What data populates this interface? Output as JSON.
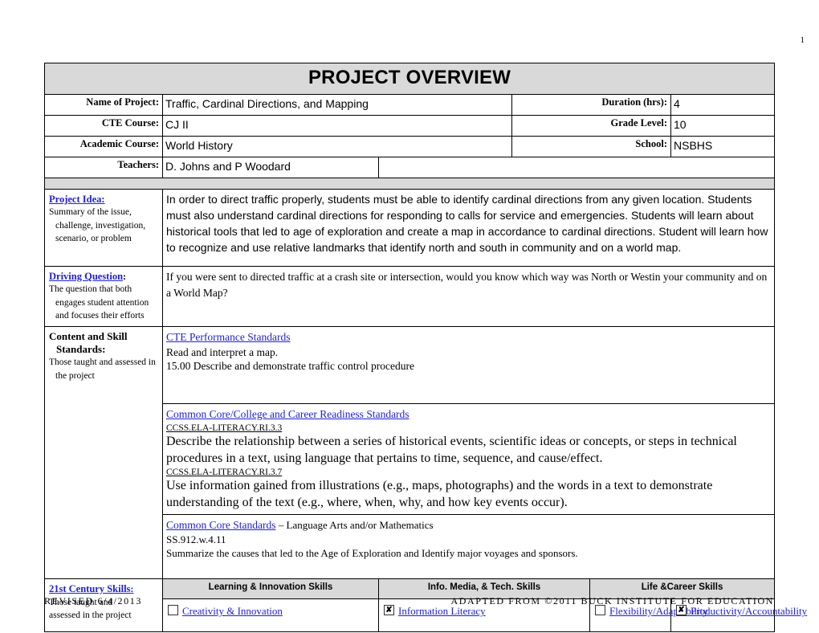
{
  "page_number": "1",
  "header": {
    "title": "PROJECT OVERVIEW"
  },
  "info_fields": {
    "name_of_project_label": "Name of Project:",
    "name_of_project_value": "Traffic, Cardinal Directions, and Mapping",
    "duration_label": "Duration (hrs):",
    "duration_value": "4",
    "cte_course_label": "CTE Course:",
    "cte_course_value": "CJ II",
    "grade_level_label": "Grade Level:",
    "grade_level_value": "10",
    "academic_course_label": "Academic Course:",
    "academic_course_value": "World History",
    "school_label": "School:",
    "school_value": "NSBHS",
    "teachers_label": "Teachers:",
    "teachers_value": "D. Johns and P Woodard"
  },
  "project_idea": {
    "label": "Project Idea:",
    "sub_lines": [
      "Summary of the issue,",
      "challenge, investigation,",
      "scenario, or problem"
    ],
    "text": "In order to direct traffic properly, students must be able to identify cardinal directions from any given location. Students must also understand cardinal directions for responding to calls for service and emergencies. Students will learn about historical tools that led to age of exploration and create a map in accordance to cardinal directions. Student will learn how to recognize and use relative landmarks that identify north and south in community and on a world map."
  },
  "driving_question": {
    "label": "Driving Question",
    "label_suffix": ":",
    "sub_lines": [
      "The question that both",
      "engages student attention",
      "and focuses their efforts"
    ],
    "text": "If you were sent to directed traffic at a crash site or intersection, would you know which way was North or Westin your community and on a World Map?"
  },
  "content_standards": {
    "label_line1": "Content and Skill",
    "label_line2": "Standards:",
    "sub_lines": [
      "Those taught and assessed in",
      "the project"
    ],
    "cte": {
      "heading": "CTE Performance Standards",
      "lines": [
        "Read and interpret a map.",
        "15.00    Describe and demonstrate traffic control procedure"
      ]
    },
    "common_core_ccr": {
      "heading": "Common Core/College and Career Readiness Standards",
      "items": [
        {
          "code": "CCSS.ELA-LITERACY.RI.3.3",
          "text": "Describe the relationship between a series of historical events, scientific ideas or concepts, or steps in technical procedures in a text, using language that pertains to time, sequence, and cause/effect."
        },
        {
          "code": "CCSS.ELA-LITERACY.RI.3.7",
          "text": "Use information gained from illustrations (e.g., maps, photographs) and the words in a text to demonstrate understanding of the text (e.g., where, when, why, and how key events occur)."
        }
      ]
    },
    "common_core_la_math": {
      "heading": "Common Core Standards",
      "heading_suffix": " – Language Arts and/or Mathematics",
      "code": "SS.912.w.4.11",
      "text": "Summarize the causes that led to the Age of Exploration and Identify major voyages and sponsors."
    }
  },
  "century_skills": {
    "label": "21st Century Skills",
    "label_suffix": ":",
    "sub_lines": [
      "Those taught and",
      "assessed in the project"
    ],
    "columns": [
      {
        "header": "Learning & Innovation Skills"
      },
      {
        "header": "Info. Media, & Tech. Skills"
      },
      {
        "header": "Life &Career Skills"
      }
    ],
    "items": [
      {
        "label": "Creativity & Innovation",
        "checked": false,
        "mark": ""
      },
      {
        "label": "Information Literacy",
        "checked": true,
        "mark": "✘"
      },
      {
        "label": "Flexibility/Adaptability",
        "checked": false,
        "mark": ""
      },
      {
        "label": "Productivity/Accountability",
        "checked": true,
        "mark": "✘"
      }
    ]
  },
  "footer": {
    "left": "REVISED 6/4/2013",
    "right": "ADAPTED FROM ©2011 BUCK INSTITUTE FOR EDUCATION"
  },
  "colors": {
    "gray_fill": "#d9d9d9",
    "link_blue": "#2222cc",
    "border": "#000000"
  }
}
